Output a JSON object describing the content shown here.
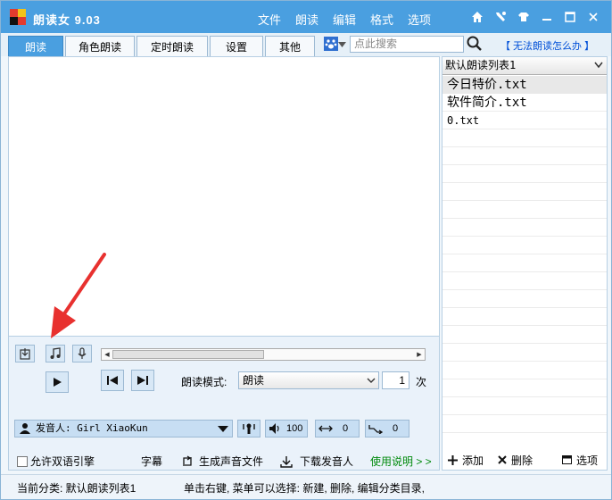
{
  "app": {
    "title": "朗读女 9.03"
  },
  "menu": [
    "文件",
    "朗读",
    "编辑",
    "格式",
    "选项"
  ],
  "window_icons": [
    "home-icon",
    "tools-icon",
    "shirt-icon",
    "minimize-icon",
    "maximize-icon",
    "close-icon"
  ],
  "tabs": [
    "朗读",
    "角色朗读",
    "定时朗读",
    "设置",
    "其他"
  ],
  "search": {
    "placeholder": "点此搜索"
  },
  "help_link": "【 无法朗读怎么办 】",
  "controls": {
    "mode_label": "朗读模式:",
    "mode_value": "朗读",
    "repeat_count": "1",
    "repeat_unit": "次",
    "speaker_label": "发音人: Girl XiaoKun",
    "volume": "100",
    "speed": "0",
    "pitch": "0",
    "dual_engine": "允许双语引擎",
    "subtitle": "字幕",
    "gen_audio": "生成声音文件",
    "download_voice": "下载发音人",
    "usage": "使用说明 > >"
  },
  "playlist": {
    "selected_list": "默认朗读列表1",
    "files": [
      "今日特价.txt",
      "软件简介.txt",
      "0.txt"
    ],
    "add": "添加",
    "delete": "删除",
    "options": "选项"
  },
  "status": {
    "category": "当前分类: 默认朗读列表1",
    "hint": "单击右键, 菜单可以选择: 新建, 删除, 编辑分类目录,"
  },
  "colors": {
    "titlebar": "#4a9fe0",
    "accent": "#3b88c6",
    "link": "#0050d8",
    "usage": "#008a0c",
    "annotation_arrow": "#e8312f"
  }
}
